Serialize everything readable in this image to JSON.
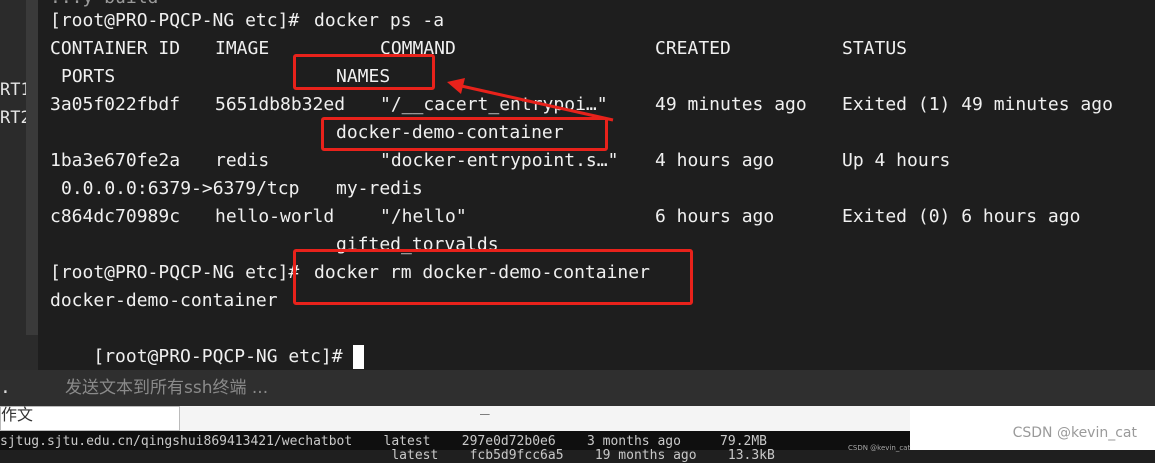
{
  "sidebar_fragments": [
    "RT1",
    "RT2"
  ],
  "terminal": {
    "prev_line": "...y build",
    "prompt": "[root@PRO-PQCP-NG etc]#",
    "cmd1": "docker ps -a",
    "headers": {
      "container_id": "CONTAINER ID",
      "image": "IMAGE",
      "command": "COMMAND",
      "created": "CREATED",
      "status": "STATUS",
      "ports": "PORTS",
      "names": "NAMES"
    },
    "rows": [
      {
        "id": "3a05f022fbdf",
        "image": "5651db8b32ed",
        "command": "\"/__cacert_entrypoi…\"",
        "created": "49 minutes ago",
        "status": "Exited (1) 49 minutes ago",
        "ports": "",
        "name": "docker-demo-container"
      },
      {
        "id": "1ba3e670fe2a",
        "image": "redis",
        "command": "\"docker-entrypoint.s…\"",
        "created": "4 hours ago",
        "status": "Up 4 hours",
        "ports": "0.0.0.0:6379->6379/tcp",
        "name": "my-redis"
      },
      {
        "id": "c864dc70989c",
        "image": "hello-world",
        "command": "\"/hello\"",
        "created": "6 hours ago",
        "status": "Exited (0) 6 hours ago",
        "ports": "",
        "name": "gifted_torvalds"
      }
    ],
    "cmd2": "docker rm docker-demo-container",
    "output2": "docker-demo-container"
  },
  "sendbar": {
    "placeholder": "发送文本到所有ssh终端 ..."
  },
  "background_window": {
    "left_text": "作文",
    "mid_text": "_",
    "row1": "sjtug.sjtu.edu.cn/qingshui869413421/wechatbot    latest    297e0d72b0e6    3 months ago     79.2MB",
    "row2": "                                                  latest    fcb5d9fcc6a5    19 months ago    13.3kB",
    "csdn_small": "CSDN @kevin_cat"
  },
  "watermark": "CSDN @kevin_cat",
  "colors": {
    "terminal_bg": "#1e1e1e",
    "text": "#f0f0f0",
    "highlight_box": "#e8221b"
  }
}
